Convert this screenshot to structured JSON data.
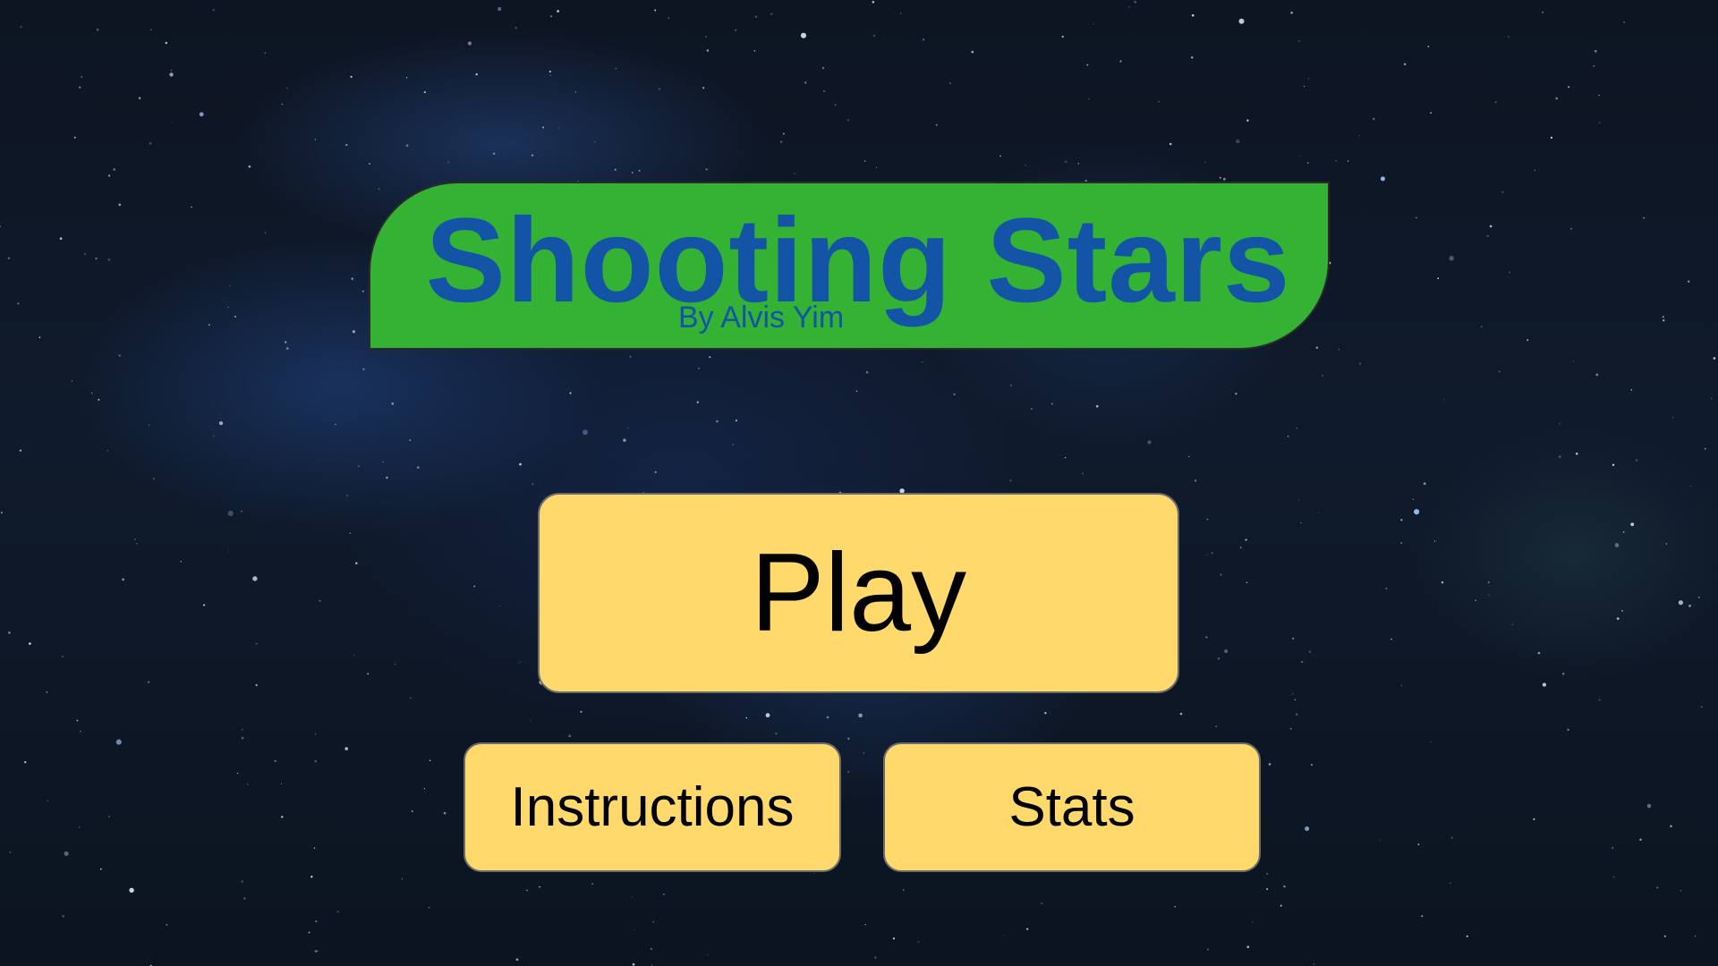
{
  "title_banner": {
    "title": "Shooting Stars",
    "subtitle": "By Alvis Yim"
  },
  "menu": {
    "play_label": "Play",
    "instructions_label": "Instructions",
    "stats_label": "Stats"
  },
  "colors": {
    "banner_green": "#34b233",
    "title_blue": "#1354a6",
    "button_yellow": "#ffd96b",
    "background_space": "#0f1a2c"
  },
  "background": {
    "icon": "starfield-icon"
  }
}
